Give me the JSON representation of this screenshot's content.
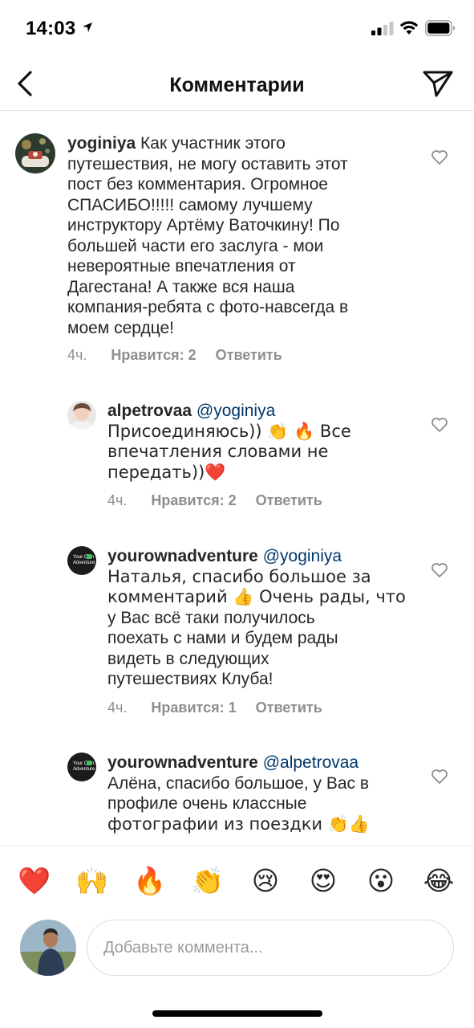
{
  "status_bar": {
    "time": "14:03"
  },
  "header": {
    "title": "Комментарии"
  },
  "comments": [
    {
      "username": "yoginiya",
      "mention": "",
      "lines": [
        "Как участник этого",
        "путешествия, не могу оставить этот",
        "пост без комментария. Огромное",
        "СПАСИБО!!!!! самому лучшему",
        "инструктору Артёму Ваточкину! По",
        "большей части его заслуга - мои",
        "невероятные впечатления от",
        "Дагестана! А также вся наша",
        "компания-ребята с фото-навсегда в",
        "моем сердце!"
      ],
      "time": "4ч.",
      "likes": "Нравится: 2",
      "reply": "Ответить"
    },
    {
      "username": "alpetrovaa",
      "mention": "@yoginiya",
      "lines": [
        "Присоединяюсь)) 👏 🔥 Все",
        "впечатления словами не",
        "передать))❤️"
      ],
      "time": "4ч.",
      "likes": "Нравится: 2",
      "reply": "Ответить"
    },
    {
      "username": "yourownadventure",
      "mention": "@yoginiya",
      "lines": [
        "Наталья, спасибо большое за",
        "комментарий 👍 Очень рады, что",
        "у Вас всё таки получилось",
        "поехать с нами и будем рады",
        "видеть в следующих",
        "путешествиях Клуба!"
      ],
      "time": "4ч.",
      "likes": "Нравится: 1",
      "reply": "Ответить"
    },
    {
      "username": "yourownadventure",
      "mention": "@alpetrovaa",
      "lines": [
        "Алёна, спасибо большое, у Вас в",
        "профиле очень классные",
        "фотографии из поездки 👏👍"
      ],
      "time": "",
      "likes": "",
      "reply": ""
    }
  ],
  "avatar_logo_text": [
    "Your Own",
    "Adventure"
  ],
  "emoji_bar": [
    "❤️",
    "🙌",
    "🔥",
    "👏",
    "😢",
    "😍",
    "😮",
    "😂"
  ],
  "input": {
    "placeholder": "Добавьте коммента..."
  },
  "colors": {
    "text": "#262626",
    "meta": "#8e8e8e",
    "mention": "#00376b",
    "heart_red": "#ed4956"
  },
  "icons": [
    "chevron-left-icon",
    "send-icon",
    "heart-outline-icon",
    "location-arrow-icon",
    "signal-icon",
    "wifi-icon",
    "battery-icon"
  ]
}
